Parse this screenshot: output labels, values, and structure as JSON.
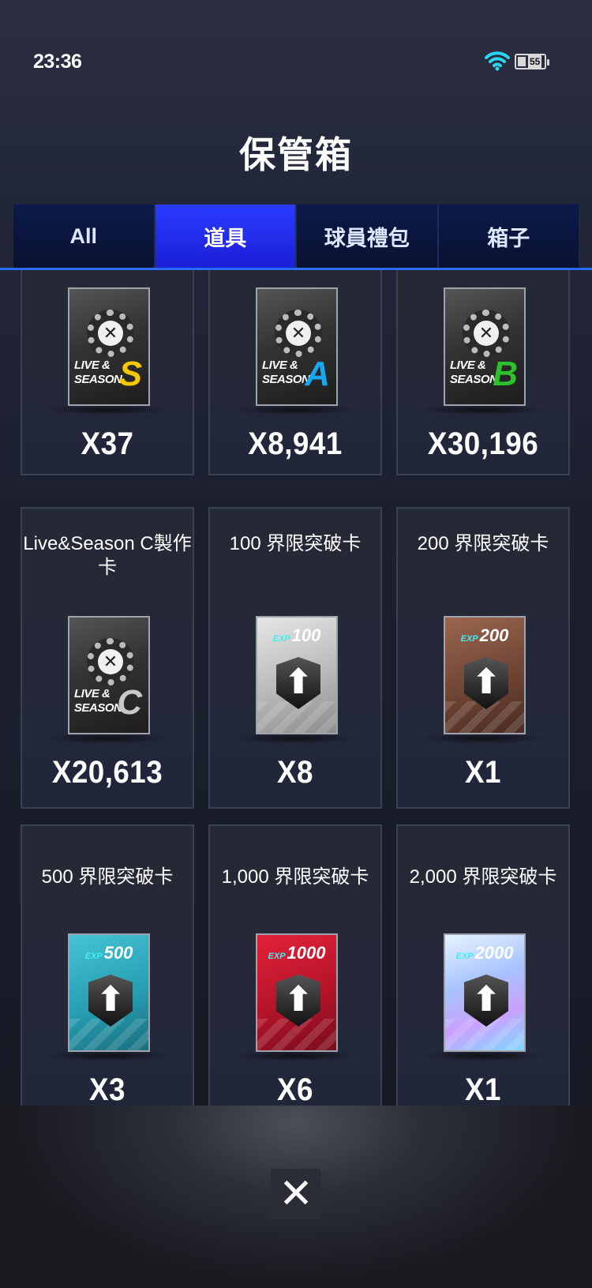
{
  "status_bar": {
    "time": "23:36",
    "battery_level": "55"
  },
  "header": {
    "title": "保管箱"
  },
  "tabs": [
    {
      "label": "All",
      "active": false
    },
    {
      "label": "道具",
      "active": true
    },
    {
      "label": "球員禮包",
      "active": false
    },
    {
      "label": "箱子",
      "active": false
    }
  ],
  "items": [
    {
      "name": "",
      "card": "craft",
      "card_text": "LIVE & SEASON",
      "grade": "S",
      "grade_color": "#f5c800",
      "qty": "X37"
    },
    {
      "name": "",
      "card": "craft",
      "card_text": "LIVE & SEASON",
      "grade": "A",
      "grade_color": "#19a8f0",
      "qty": "X8,941"
    },
    {
      "name": "",
      "card": "craft",
      "card_text": "LIVE & SEASON",
      "grade": "B",
      "grade_color": "#2ec12e",
      "qty": "X30,196"
    },
    {
      "name": "Live&Season C製作卡",
      "card": "craft",
      "card_text": "LIVE & SEASON",
      "grade": "C",
      "grade_color": "#c8c8c8",
      "qty": "X20,613"
    },
    {
      "name": "100 界限突破卡",
      "card": "exp",
      "exp": "100",
      "bg": "linear-gradient(160deg,#e6e6e6 0%,#b9b9b9 55%,#8d8d8d 100%)",
      "qty": "X8"
    },
    {
      "name": "200 界限突破卡",
      "card": "exp",
      "exp": "200",
      "bg": "linear-gradient(160deg,#9a6650 0%,#6f4534 55%,#4a2c21 100%)",
      "qty": "X1"
    },
    {
      "name": "500 界限突破卡",
      "card": "exp",
      "exp": "500",
      "bg": "linear-gradient(160deg,#46c3d6 0%,#279fb3 55%,#1a6f7e 100%)",
      "qty": "X3"
    },
    {
      "name": "1,000 界限突破卡",
      "card": "exp",
      "exp": "1000",
      "bg": "linear-gradient(160deg,#e2223a 0%,#b5142a 55%,#7a0c1c 100%)",
      "qty": "X6"
    },
    {
      "name": "2,000 界限突破卡",
      "card": "exp",
      "exp": "2000",
      "bg": "linear-gradient(160deg,#e6f4ff 0%,#a8c4ff 40%,#c9a0ff 70%,#7fd8ff 100%)",
      "qty": "X1"
    }
  ],
  "close": {
    "icon": "close-icon",
    "symbol": "✕"
  },
  "exp_prefix": "EXP"
}
